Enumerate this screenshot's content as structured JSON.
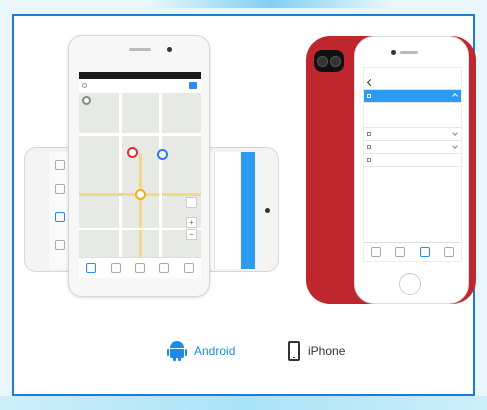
{
  "platforms": {
    "android_label": "Android",
    "iphone_label": "iPhone"
  },
  "colors": {
    "frame_border": "#1b7ed4",
    "android_accent": "#1a8be8",
    "iphone_body": "#c0262e",
    "app_blue": "#2b9cf2"
  },
  "icons": {
    "android": "android-robot-icon",
    "iphone": "smartphone-icon"
  }
}
